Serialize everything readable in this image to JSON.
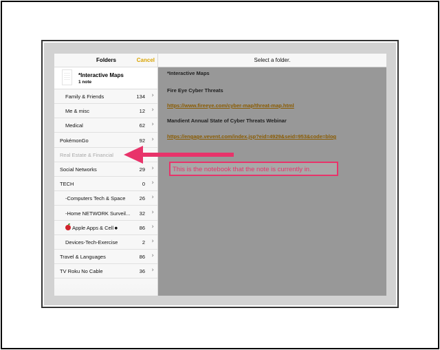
{
  "sidebar": {
    "title": "Folders",
    "cancel_label": "Cancel",
    "note_preview": {
      "title": "*Interactive Maps",
      "count": "1 note"
    },
    "folders": [
      {
        "name": "Family & Friends",
        "count": "134",
        "indent": true,
        "disabled": false
      },
      {
        "name": "Me & misc",
        "count": "12",
        "indent": true,
        "disabled": false
      },
      {
        "name": "Medical",
        "count": "62",
        "indent": true,
        "disabled": false
      },
      {
        "name": "PokémonGo",
        "count": "92",
        "indent": false,
        "disabled": false
      },
      {
        "name": "Real Estate & Financial",
        "count": "",
        "indent": false,
        "disabled": true
      },
      {
        "name": "Social Networks",
        "count": "29",
        "indent": false,
        "disabled": false
      },
      {
        "name": "TECH",
        "count": "0",
        "indent": false,
        "disabled": false
      },
      {
        "name": "-Computers Tech & Space",
        "count": "26",
        "indent": true,
        "disabled": false
      },
      {
        "name": "-Home NETWORK Surveil...",
        "count": "32",
        "indent": true,
        "disabled": false
      },
      {
        "name": "Apple Apps & Cell",
        "count": "86",
        "indent": true,
        "disabled": false,
        "icon": "red-apple-icon",
        "suffix": ""
      },
      {
        "name": "Devices-Tech-Exercise",
        "count": "2",
        "indent": true,
        "disabled": false
      },
      {
        "name": "Travel & Languages",
        "count": "86",
        "indent": false,
        "disabled": false
      },
      {
        "name": "TV Roku No Cable",
        "count": "36",
        "indent": false,
        "disabled": false
      }
    ],
    "chevron": "›"
  },
  "content": {
    "header": "Select a folder.",
    "lines": [
      {
        "text": "*Interactive Maps",
        "link": false
      },
      {
        "text": "Fire Eye Cyber Threats",
        "link": false
      },
      {
        "text": "https://www.fireeye.com/cyber-map/threat-map.html",
        "link": true
      },
      {
        "text": "Mandient Annual State of Cyber Threats Webinar",
        "link": false
      },
      {
        "text": "https://engage.vevent.com/index.jsp?eid=4929&seid=953&code=blog",
        "link": true
      }
    ]
  },
  "annotation": {
    "callout_text": "This is the notebook that the note is currently in.",
    "color": "#e8336a"
  },
  "toolbar": {
    "icons": [
      "checklist-icon",
      "sketch-icon",
      "camera-icon"
    ]
  }
}
